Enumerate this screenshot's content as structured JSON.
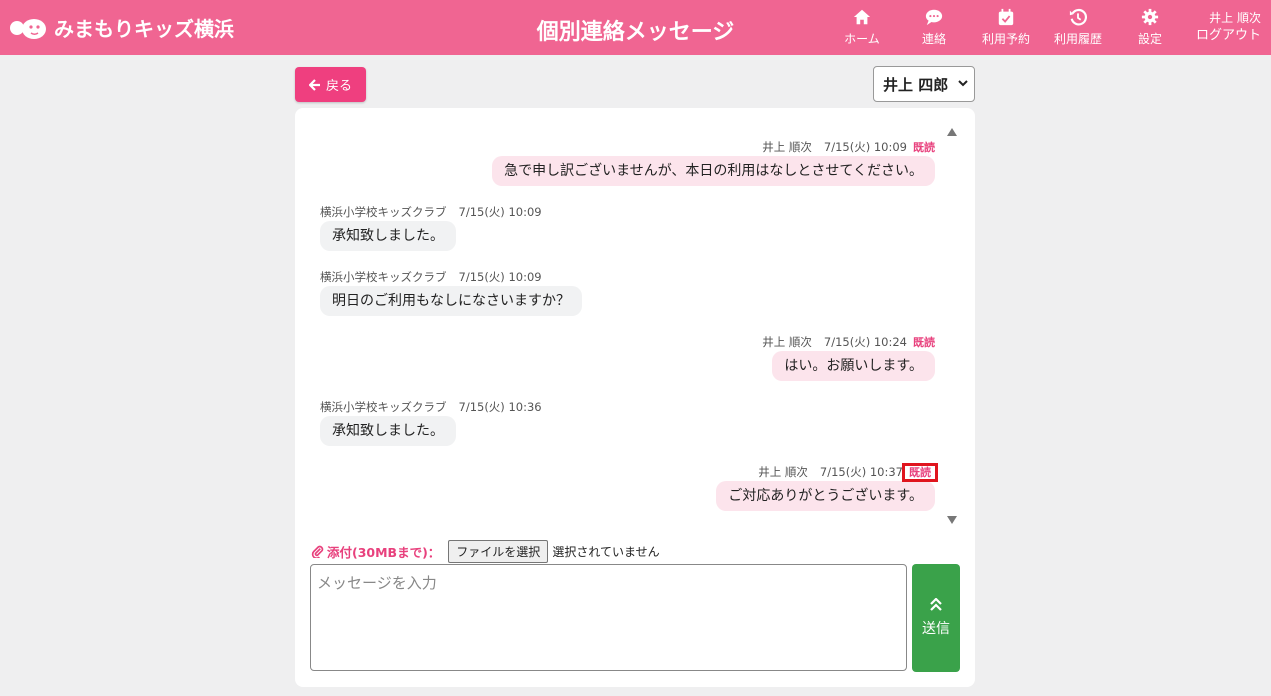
{
  "colors": {
    "brand": "#f06592",
    "accent": "#ef3f7f",
    "read": "#e8417d",
    "send": "#3aa24a",
    "highlight": "#e0151e"
  },
  "header": {
    "logo_text": "みまもりキッズ横浜",
    "title": "個別連絡メッセージ",
    "nav": [
      {
        "label": "ホーム",
        "icon": "home-icon"
      },
      {
        "label": "連絡",
        "icon": "chat-icon"
      },
      {
        "label": "利用予約",
        "icon": "calendar-check-icon"
      },
      {
        "label": "利用履歴",
        "icon": "history-icon"
      },
      {
        "label": "設定",
        "icon": "gear-icon"
      }
    ],
    "user_name": "井上 順次",
    "logout_label": "ログアウト"
  },
  "toolbar": {
    "back_label": "戻る",
    "recipient_selected": "井上 四郎"
  },
  "messages": [
    {
      "side": "right",
      "sender": "井上 順次",
      "time": "7/15(火) 10:09",
      "read": "既読",
      "text": "急で申し訳ございませんが、本日の利用はなしとさせてください。"
    },
    {
      "side": "left",
      "sender": "横浜小学校キッズクラブ",
      "time": "7/15(火) 10:09",
      "text": "承知致しました。"
    },
    {
      "side": "left",
      "sender": "横浜小学校キッズクラブ",
      "time": "7/15(火) 10:09",
      "text": "明日のご利用もなしになさいますか？"
    },
    {
      "side": "right",
      "sender": "井上 順次",
      "time": "7/15(火) 10:24",
      "read": "既読",
      "text": "はい。お願いします。"
    },
    {
      "side": "left",
      "sender": "横浜小学校キッズクラブ",
      "time": "7/15(火) 10:36",
      "text": "承知致しました。"
    },
    {
      "side": "right",
      "sender": "井上 順次",
      "time": "7/15(火) 10:37",
      "read": "既読",
      "text": "ご対応ありがとうございます。"
    }
  ],
  "composer": {
    "attach_label": "添付(30MBまで)：",
    "file_button": "ファイルを選択",
    "file_status": "選択されていません",
    "placeholder": "メッセージを入力",
    "send_label": "送信"
  }
}
